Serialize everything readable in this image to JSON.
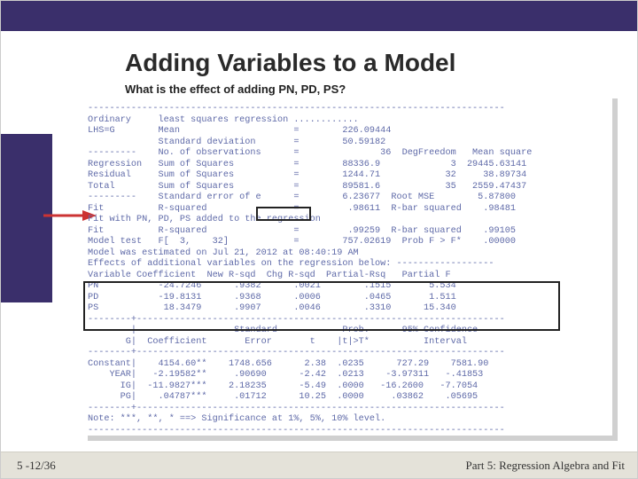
{
  "title": "Adding Variables to a Model",
  "subtitle": "What is the effect of adding PN, PD, PS?",
  "footer_left": "5 -12/36",
  "footer_right": "Part 5: Regression Algebra and Fit",
  "boxed_value": ".99259",
  "output": "-----------------------------------------------------------------------------\nOrdinary     least squares regression ............\nLHS=G        Mean                     =        226.09444\n             Standard deviation       =        50.59182\n---------    No. of observations      =               36  DegFreedom   Mean square\nRegression   Sum of Squares           =        88336.9             3  29445.63141\nResidual     Sum of Squares           =        1244.71            32     38.89734\nTotal        Sum of Squares           =        89581.6            35   2559.47437\n---------    Standard error of e      =        6.23677  Root MSE        5.87800\nFit          R-squared                =         .98611  R-bar squared    .98481\nFit with PN, PD, PS added to the regression\nFit          R-squared                =         .99259  R-bar squared    .99105\nModel test   F[  3,    32]            =        757.02619  Prob F > F*    .00000\nModel was estimated on Jul 21, 2012 at 08:40:19 AM\nEffects of additional variables on the regression below: ------------------\nVariable Coefficient  New R-sqd  Chg R-sqd  Partial-Rsq   Partial F\nPN           -24.7246      .9382      .0021        .1515       5.534\nPD           -19.8131      .9368      .0006        .0465       1.511\nPS            18.3479      .9907      .0046        .3310      15.340\n--------+--------------------------------------------------------------------\n        |                  Standard            Prob.      95% Confidence\n       G|  Coefficient       Error       t    |t|>T*          Interval\n--------+--------------------------------------------------------------------\nConstant|    4154.60**    1748.656      2.38  .0235      727.29    7581.90\n    YEAR|   -2.19582**     .90690      -2.42  .0213    -3.97311   -.41853\n      IG|  -11.9827***    2.18235      -5.49  .0000   -16.2600   -7.7054\n      PG|    .04787***     .01712      10.25  .0000     .03862    .05695\n--------+--------------------------------------------------------------------\nNote: ***, **, * ==> Significance at 1%, 5%, 10% level.\n-----------------------------------------------------------------------------"
}
